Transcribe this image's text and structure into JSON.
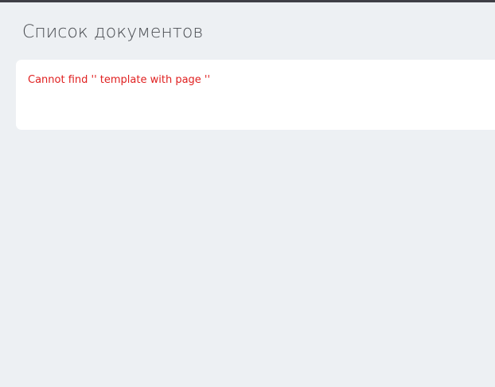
{
  "header": {
    "title": "Список документов"
  },
  "content": {
    "error_message": "Cannot find '' template with page ''"
  },
  "colors": {
    "background": "#edf0f3",
    "panel": "#ffffff",
    "error_text": "#e02020",
    "title_text": "#4a4d52",
    "top_bar": "#3f3f46"
  }
}
